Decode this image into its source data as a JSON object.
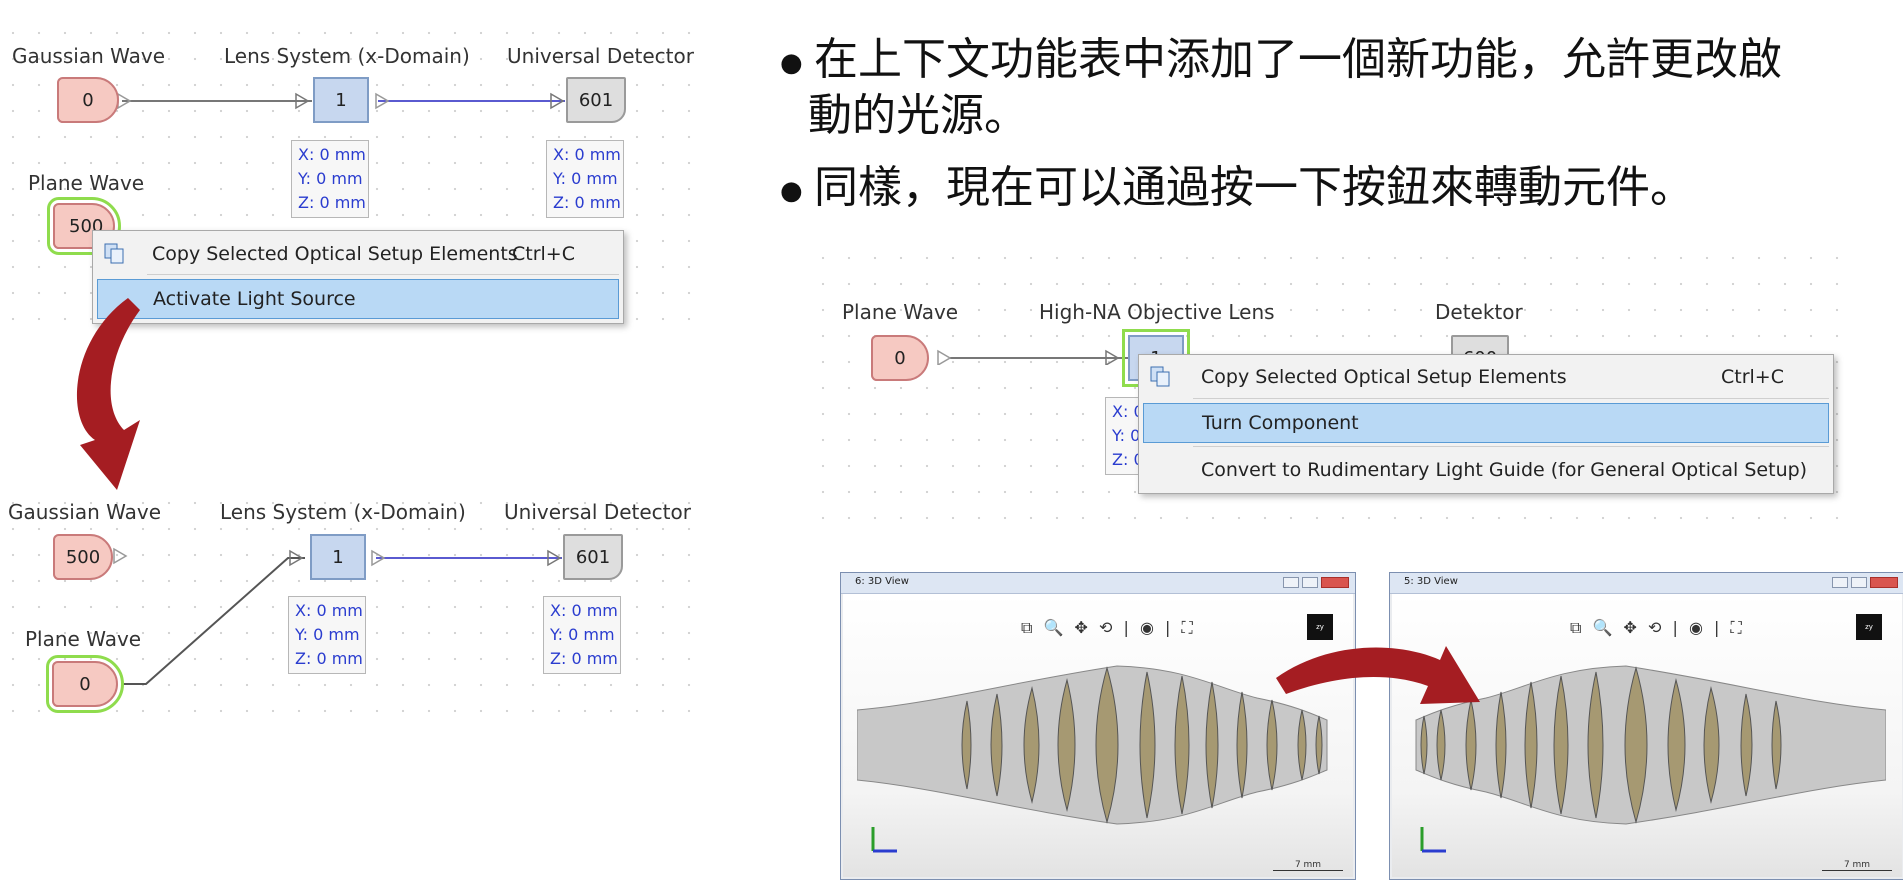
{
  "bullets": [
    {
      "symbol": "●",
      "line1": "在上下文功能表中添加了一個新功能，允許更改啟",
      "line2": "動的光源。"
    },
    {
      "symbol": "●",
      "line1": "同樣，現在可以通過按一下按鈕來轉動元件。"
    }
  ],
  "setup_top": {
    "labels": {
      "source1": "Gaussian Wave",
      "lens": "Lens System (x-Domain)",
      "detector": "Universal Detector",
      "source2": "Plane Wave"
    },
    "source1_value": "0",
    "source2_value": "500",
    "lens_value": "1",
    "detector_value": "601",
    "lens_coords": {
      "x": "X: 0 mm",
      "y": "Y: 0 mm",
      "z": "Z: 0 mm"
    },
    "det_coords": {
      "x": "X: 0 mm",
      "y": "Y: 0 mm",
      "z": "Z: 0 mm"
    },
    "menu": {
      "copy": "Copy Selected Optical Setup Elements",
      "copy_key": "Ctrl+C",
      "activate": "Activate Light Source"
    }
  },
  "setup_bottom": {
    "labels": {
      "source1": "Gaussian Wave",
      "lens": "Lens System (x-Domain)",
      "detector": "Universal Detector",
      "source2": "Plane Wave"
    },
    "source1_value": "500",
    "source2_value": "0",
    "lens_value": "1",
    "detector_value": "601",
    "lens_coords": {
      "x": "X: 0 mm",
      "y": "Y: 0 mm",
      "z": "Z: 0 mm"
    },
    "det_coords": {
      "x": "X: 0 mm",
      "y": "Y: 0 mm",
      "z": "Z: 0 mm"
    }
  },
  "setup_right": {
    "labels": {
      "source": "Plane Wave",
      "lens": "High-NA Objective Lens",
      "detector": "Detektor"
    },
    "source_value": "0",
    "lens_value": "1",
    "detector_value": "600",
    "coords_partial": {
      "x": "X: 0",
      "y": "Y: 0",
      "z": "Z: 0"
    },
    "menu": {
      "copy": "Copy Selected Optical Setup Elements",
      "copy_key": "Ctrl+C",
      "turn": "Turn Component",
      "convert": "Convert to Rudimentary Light Guide (for General Optical Setup)"
    }
  },
  "views": [
    {
      "title": "6: 3D View",
      "tools": "⧉ 🔍 ✥ ⟲ | ◉ | ⛶",
      "cube": "zy",
      "scale": "7 mm"
    },
    {
      "title": "5: 3D View",
      "tools": "⧉ 🔍 ✥ ⟲ | ◉ | ⛶",
      "cube": "zy",
      "scale": "7 mm"
    }
  ],
  "colors": {
    "arrow": "#a51d22",
    "selection": "#8fdc4d",
    "highlight": "#b9d9f5",
    "coords_text": "#2a3ccf"
  }
}
